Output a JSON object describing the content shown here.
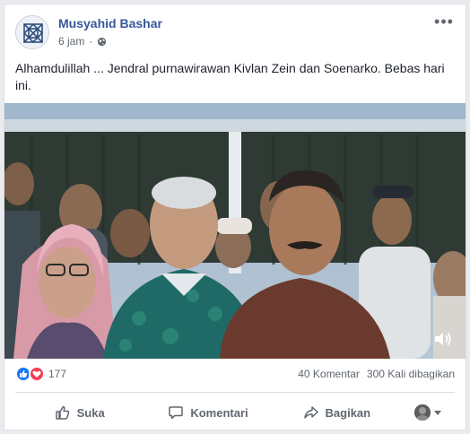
{
  "post": {
    "author": "Musyahid Bashar",
    "time": "6 jam",
    "more_label": "•••",
    "text": "Alhamdulillah ... Jendral purnawirawan Kivlan Zein dan Soenarko. Bebas hari ini.",
    "privacy_icon": "globe-icon",
    "avatar_icon": "geometric-pattern-avatar"
  },
  "video": {
    "volume_icon": "volume-icon"
  },
  "reactions": {
    "types": [
      "like",
      "love"
    ],
    "count": "177",
    "comments": "40 Komentar",
    "shares": "300 Kali dibagikan"
  },
  "actions": {
    "like": "Suka",
    "comment": "Komentari",
    "share": "Bagikan"
  },
  "colors": {
    "link": "#365899",
    "like": "#1877f2",
    "love": "#f33e58",
    "muted": "#606770"
  }
}
